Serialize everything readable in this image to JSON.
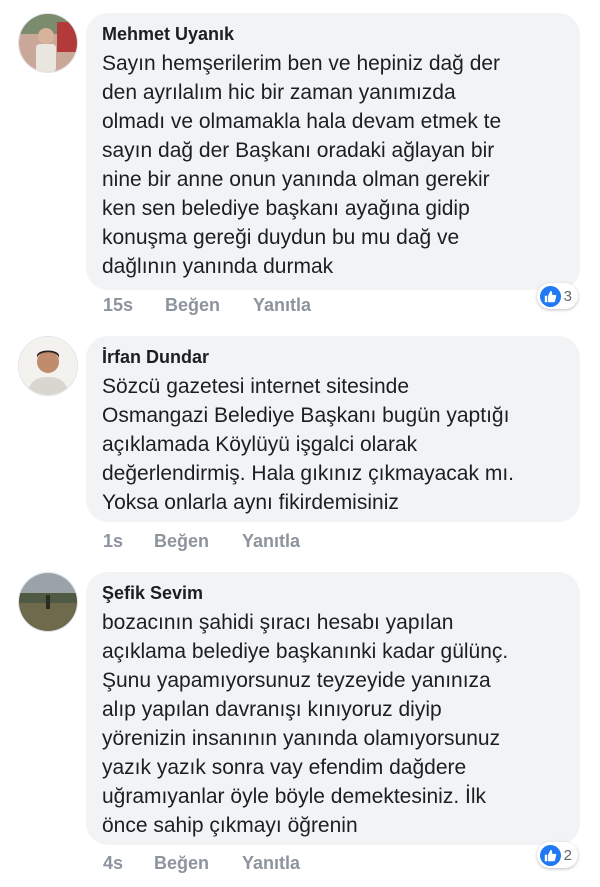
{
  "comments": [
    {
      "author": "Mehmet Uyanık",
      "lines": [
        "Sayın hemşerilerim ben ve hepiniz dağ der",
        "den ayrılalım hic bir zaman yanımızda",
        "olmadı ve olmamakla hala devam etmek te",
        "sayın dağ der Başkanı oradaki ağlayan bir",
        "nine bir anne onun yanında olman gerekir",
        "ken sen belediye başkanı ayağına gidip",
        "konuşma gereği duydun bu mu dağ ve",
        "dağlının yanında durmak"
      ],
      "time": "15s",
      "like_label": "Beğen",
      "reply_label": "Yanıtla",
      "reaction_count": "3",
      "reaction_icon": "thumbs-up-icon"
    },
    {
      "author": "İrfan Dundar",
      "lines": [
        "Sözcü gazetesi internet sitesinde",
        "Osmangazi Belediye Başkanı bugün yaptığı",
        "açıklamada Köylüyü işgalci olarak",
        "değerlendirmiş. Hala gıkınız çıkmayacak mı.",
        "Yoksa onlarla aynı fikirdemisiniz"
      ],
      "time": "1s",
      "like_label": "Beğen",
      "reply_label": "Yanıtla"
    },
    {
      "author": "Şefik Sevim",
      "lines": [
        "bozacının şahidi şıracı hesabı yapılan",
        "açıklama belediye başkanınki kadar gülünç.",
        "Şunu yapamıyorsunuz teyzeyide yanınıza",
        "alıp yapılan davranışı kınıyoruz diyip",
        "yörenizin insanının yanında olamıyorsunuz",
        "yazık yazık sonra vay efendim dağdere",
        "uğramıyanlar öyle böyle demektesiniz. İlk",
        "önce sahip çıkmayı öğrenin"
      ],
      "time": "4s",
      "like_label": "Beğen",
      "reply_label": "Yanıtla",
      "reaction_count": "2",
      "reaction_icon": "thumbs-up-icon"
    }
  ],
  "colors": {
    "bubble": "#f2f3f5",
    "meta": "#8d949e",
    "like_blue": "#2078f4"
  }
}
